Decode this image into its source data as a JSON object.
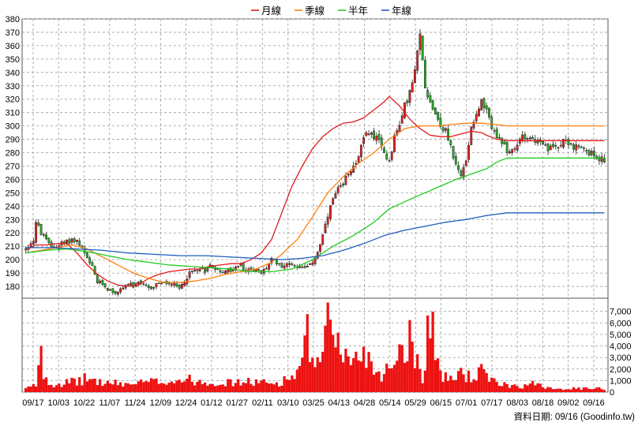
{
  "legend": [
    {
      "label": "月線",
      "color": "#e31a1c"
    },
    {
      "label": "季線",
      "color": "#ff7f0e"
    },
    {
      "label": "半年",
      "color": "#22cc22"
    },
    {
      "label": "年線",
      "color": "#1f5fbf"
    }
  ],
  "footer_text": "資料日期: 09/16  (Goodinfo.tw)",
  "chart_data": {
    "type": "candlestick",
    "price_axis": {
      "ylim": [
        170,
        380
      ],
      "ticks": [
        180,
        190,
        200,
        210,
        220,
        230,
        240,
        250,
        260,
        270,
        280,
        290,
        300,
        310,
        320,
        330,
        340,
        350,
        360,
        370,
        380
      ]
    },
    "volume_axis": {
      "ylim": [
        0,
        8000
      ],
      "ticks": [
        0,
        1000,
        2000,
        3000,
        4000,
        5000,
        6000,
        7000
      ],
      "tick_labels": [
        "0",
        "1,000",
        "2,000",
        "3,000",
        "4,000",
        "5,000",
        "6,000",
        "7,000"
      ]
    },
    "x_tick_labels": [
      "09/17",
      "10/03",
      "10/22",
      "11/07",
      "11/24",
      "12/09",
      "12/24",
      "01/12",
      "01/27",
      "02/11",
      "03/10",
      "03/25",
      "04/13",
      "04/28",
      "05/14",
      "05/29",
      "06/15",
      "07/01",
      "07/17",
      "08/03",
      "08/18",
      "09/02",
      "09/16"
    ],
    "ma_series": [
      {
        "name": "月線",
        "color": "#e31a1c",
        "points": [
          [
            0,
            207
          ],
          [
            4,
            211
          ],
          [
            8,
            211
          ],
          [
            12,
            212
          ],
          [
            16,
            212
          ],
          [
            20,
            205
          ],
          [
            24,
            196
          ],
          [
            28,
            189
          ],
          [
            32,
            184
          ],
          [
            36,
            181
          ],
          [
            40,
            180
          ],
          [
            44,
            181
          ],
          [
            48,
            186
          ],
          [
            52,
            189
          ],
          [
            56,
            191
          ],
          [
            60,
            192
          ],
          [
            64,
            193
          ],
          [
            68,
            193
          ],
          [
            72,
            195
          ],
          [
            76,
            196
          ],
          [
            80,
            197
          ],
          [
            84,
            197
          ],
          [
            88,
            200
          ],
          [
            92,
            205
          ],
          [
            96,
            215
          ],
          [
            100,
            235
          ],
          [
            104,
            255
          ],
          [
            108,
            270
          ],
          [
            112,
            283
          ],
          [
            116,
            292
          ],
          [
            120,
            298
          ],
          [
            124,
            302
          ],
          [
            128,
            303
          ],
          [
            132,
            306
          ],
          [
            136,
            312
          ],
          [
            140,
            318
          ],
          [
            142,
            322
          ],
          [
            146,
            315
          ],
          [
            150,
            305
          ],
          [
            154,
            298
          ],
          [
            158,
            293
          ],
          [
            162,
            292
          ],
          [
            166,
            292
          ],
          [
            170,
            294
          ],
          [
            174,
            296
          ],
          [
            178,
            295
          ],
          [
            180,
            293
          ],
          [
            184,
            290
          ],
          [
            188,
            289
          ]
        ]
      },
      {
        "name": "季線",
        "color": "#ff7f0e",
        "points": [
          [
            0,
            205
          ],
          [
            6,
            207
          ],
          [
            12,
            209
          ],
          [
            18,
            211
          ],
          [
            24,
            208
          ],
          [
            30,
            202
          ],
          [
            36,
            196
          ],
          [
            42,
            190
          ],
          [
            48,
            186
          ],
          [
            54,
            183
          ],
          [
            60,
            183
          ],
          [
            66,
            184
          ],
          [
            72,
            186
          ],
          [
            78,
            189
          ],
          [
            84,
            191
          ],
          [
            90,
            193
          ],
          [
            96,
            198
          ],
          [
            100,
            204
          ],
          [
            106,
            215
          ],
          [
            112,
            232
          ],
          [
            118,
            250
          ],
          [
            124,
            262
          ],
          [
            130,
            272
          ],
          [
            136,
            280
          ],
          [
            142,
            290
          ],
          [
            148,
            298
          ],
          [
            154,
            300
          ],
          [
            160,
            300
          ],
          [
            166,
            301
          ],
          [
            172,
            302
          ],
          [
            178,
            302
          ],
          [
            184,
            301
          ],
          [
            188,
            300
          ]
        ]
      },
      {
        "name": "半年",
        "color": "#22cc22",
        "points": [
          [
            0,
            205
          ],
          [
            8,
            207
          ],
          [
            16,
            208
          ],
          [
            24,
            206
          ],
          [
            32,
            203
          ],
          [
            40,
            200
          ],
          [
            48,
            198
          ],
          [
            56,
            196
          ],
          [
            64,
            195
          ],
          [
            72,
            194
          ],
          [
            80,
            193
          ],
          [
            88,
            191
          ],
          [
            96,
            191
          ],
          [
            104,
            193
          ],
          [
            112,
            200
          ],
          [
            120,
            210
          ],
          [
            128,
            218
          ],
          [
            136,
            228
          ],
          [
            142,
            238
          ],
          [
            150,
            245
          ],
          [
            156,
            250
          ],
          [
            162,
            255
          ],
          [
            168,
            260
          ],
          [
            174,
            264
          ],
          [
            180,
            268
          ],
          [
            184,
            273
          ],
          [
            188,
            276
          ]
        ]
      },
      {
        "name": "年線",
        "color": "#1f5fbf",
        "points": [
          [
            0,
            209
          ],
          [
            10,
            209
          ],
          [
            20,
            208
          ],
          [
            30,
            207
          ],
          [
            40,
            205
          ],
          [
            50,
            204
          ],
          [
            60,
            203
          ],
          [
            70,
            203
          ],
          [
            80,
            202
          ],
          [
            90,
            201
          ],
          [
            100,
            200
          ],
          [
            108,
            201
          ],
          [
            116,
            203
          ],
          [
            124,
            207
          ],
          [
            132,
            212
          ],
          [
            140,
            218
          ],
          [
            148,
            222
          ],
          [
            156,
            225
          ],
          [
            164,
            228
          ],
          [
            172,
            230
          ],
          [
            180,
            233
          ],
          [
            188,
            235
          ]
        ]
      }
    ],
    "price_anchors": [
      [
        0,
        208
      ],
      [
        3,
        215
      ],
      [
        4,
        228
      ],
      [
        6,
        220
      ],
      [
        8,
        214
      ],
      [
        10,
        210
      ],
      [
        12,
        210
      ],
      [
        14,
        212
      ],
      [
        16,
        213
      ],
      [
        18,
        215
      ],
      [
        20,
        214
      ],
      [
        22,
        208
      ],
      [
        24,
        200
      ],
      [
        26,
        194
      ],
      [
        28,
        183
      ],
      [
        30,
        182
      ],
      [
        32,
        178
      ],
      [
        34,
        176
      ],
      [
        36,
        175
      ],
      [
        38,
        180
      ],
      [
        40,
        182
      ],
      [
        42,
        180
      ],
      [
        44,
        182
      ],
      [
        46,
        181
      ],
      [
        48,
        178
      ],
      [
        50,
        180
      ],
      [
        52,
        183
      ],
      [
        54,
        182
      ],
      [
        56,
        182
      ],
      [
        58,
        181
      ],
      [
        60,
        178
      ],
      [
        62,
        184
      ],
      [
        64,
        190
      ],
      [
        66,
        192
      ],
      [
        68,
        194
      ],
      [
        70,
        192
      ],
      [
        72,
        196
      ],
      [
        74,
        194
      ],
      [
        76,
        190
      ],
      [
        78,
        192
      ],
      [
        80,
        192
      ],
      [
        82,
        194
      ],
      [
        84,
        196
      ],
      [
        86,
        190
      ],
      [
        88,
        194
      ],
      [
        90,
        192
      ],
      [
        92,
        190
      ],
      [
        94,
        194
      ],
      [
        96,
        200
      ],
      [
        98,
        198
      ],
      [
        100,
        196
      ],
      [
        102,
        196
      ],
      [
        104,
        198
      ],
      [
        106,
        194
      ],
      [
        108,
        196
      ],
      [
        110,
        194
      ],
      [
        112,
        198
      ],
      [
        114,
        206
      ],
      [
        116,
        218
      ],
      [
        118,
        232
      ],
      [
        120,
        245
      ],
      [
        122,
        252
      ],
      [
        124,
        255
      ],
      [
        126,
        266
      ],
      [
        128,
        270
      ],
      [
        130,
        278
      ],
      [
        132,
        290
      ],
      [
        134,
        296
      ],
      [
        136,
        292
      ],
      [
        138,
        288
      ],
      [
        140,
        280
      ],
      [
        142,
        274
      ],
      [
        144,
        292
      ],
      [
        146,
        300
      ],
      [
        148,
        315
      ],
      [
        150,
        325
      ],
      [
        152,
        340
      ],
      [
        154,
        368
      ],
      [
        156,
        330
      ],
      [
        158,
        318
      ],
      [
        160,
        310
      ],
      [
        162,
        300
      ],
      [
        164,
        296
      ],
      [
        166,
        285
      ],
      [
        168,
        270
      ],
      [
        170,
        262
      ],
      [
        172,
        275
      ],
      [
        174,
        300
      ],
      [
        176,
        310
      ],
      [
        178,
        318
      ],
      [
        180,
        310
      ],
      [
        182,
        300
      ],
      [
        184,
        292
      ],
      [
        186,
        286
      ],
      [
        188,
        282
      ],
      [
        190,
        280
      ],
      [
        192,
        285
      ],
      [
        194,
        294
      ],
      [
        196,
        292
      ],
      [
        198,
        290
      ],
      [
        200,
        288
      ],
      [
        202,
        285
      ],
      [
        204,
        282
      ],
      [
        206,
        284
      ],
      [
        208,
        286
      ],
      [
        210,
        290
      ],
      [
        212,
        288
      ],
      [
        214,
        284
      ],
      [
        216,
        283
      ],
      [
        218,
        282
      ],
      [
        220,
        280
      ],
      [
        222,
        278
      ],
      [
        224,
        276
      ],
      [
        226,
        274
      ]
    ],
    "volume_anchors": [
      [
        0,
        300
      ],
      [
        4,
        600
      ],
      [
        5,
        2500
      ],
      [
        6,
        4500
      ],
      [
        7,
        1500
      ],
      [
        10,
        700
      ],
      [
        20,
        900
      ],
      [
        24,
        1200
      ],
      [
        30,
        800
      ],
      [
        40,
        700
      ],
      [
        50,
        900
      ],
      [
        58,
        1000
      ],
      [
        62,
        1100
      ],
      [
        70,
        900
      ],
      [
        80,
        800
      ],
      [
        90,
        900
      ],
      [
        96,
        700
      ],
      [
        100,
        900
      ],
      [
        105,
        1500
      ],
      [
        108,
        2200
      ],
      [
        110,
        5000
      ],
      [
        112,
        2500
      ],
      [
        115,
        2000
      ],
      [
        118,
        6500
      ],
      [
        120,
        3500
      ],
      [
        122,
        5500
      ],
      [
        125,
        3000
      ],
      [
        128,
        2500
      ],
      [
        132,
        3800
      ],
      [
        136,
        2000
      ],
      [
        140,
        1500
      ],
      [
        146,
        3800
      ],
      [
        150,
        4600
      ],
      [
        152,
        3500
      ],
      [
        155,
        1200
      ],
      [
        158,
        7600
      ],
      [
        160,
        3400
      ],
      [
        162,
        1800
      ],
      [
        165,
        900
      ],
      [
        170,
        1800
      ],
      [
        174,
        1200
      ],
      [
        176,
        1400
      ],
      [
        178,
        1800
      ],
      [
        182,
        900
      ],
      [
        186,
        700
      ],
      [
        190,
        600
      ],
      [
        196,
        500
      ],
      [
        200,
        900
      ],
      [
        204,
        400
      ],
      [
        210,
        300
      ]
    ]
  }
}
